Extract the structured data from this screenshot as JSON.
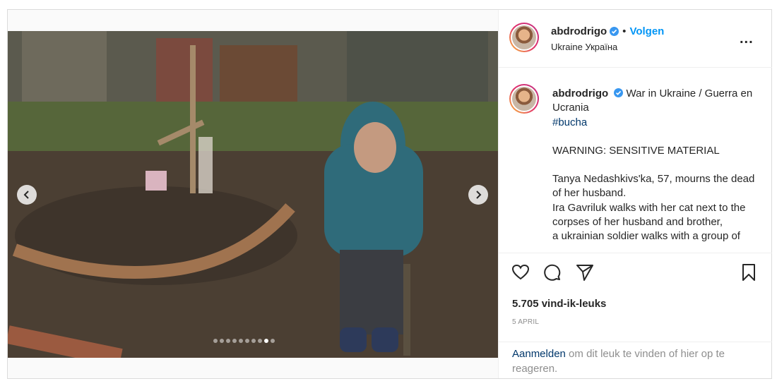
{
  "post": {
    "username": "abdrodrigo",
    "follow_label": "Volgen",
    "separator": "•",
    "location": "Ukraine Україна",
    "more_label": "..."
  },
  "caption": {
    "username": "abdrodrigo",
    "title": "War in Ukraine / Guerra en Ucrania",
    "hashtag": "#bucha",
    "warning": "WARNING: SENSITIVE MATERIAL",
    "line1": "Tanya Nedashkivs'ka, 57, mourns the dead of her husband.",
    "line2": "Ira Gavriluk walks with her cat next to the corpses of her husband and brother,",
    "line3": "a ukrainian soldier walks with a group of"
  },
  "carousel": {
    "total_slides": 10,
    "active_slide": 9
  },
  "stats": {
    "likes": "5.705 vind-ik-leuks",
    "date": "5 APRIL"
  },
  "login_prompt": {
    "link": "Aanmelden",
    "rest": " om dit leuk te vinden of hier op te reageren."
  },
  "icons": {
    "verified": "verified-badge-icon",
    "like": "heart-icon",
    "comment": "comment-icon",
    "share": "share-icon",
    "save": "bookmark-icon",
    "prev": "chevron-left-icon",
    "next": "chevron-right-icon"
  },
  "colors": {
    "link_blue": "#0095f6",
    "hashtag": "#00376b",
    "verified": "#3897f0"
  }
}
